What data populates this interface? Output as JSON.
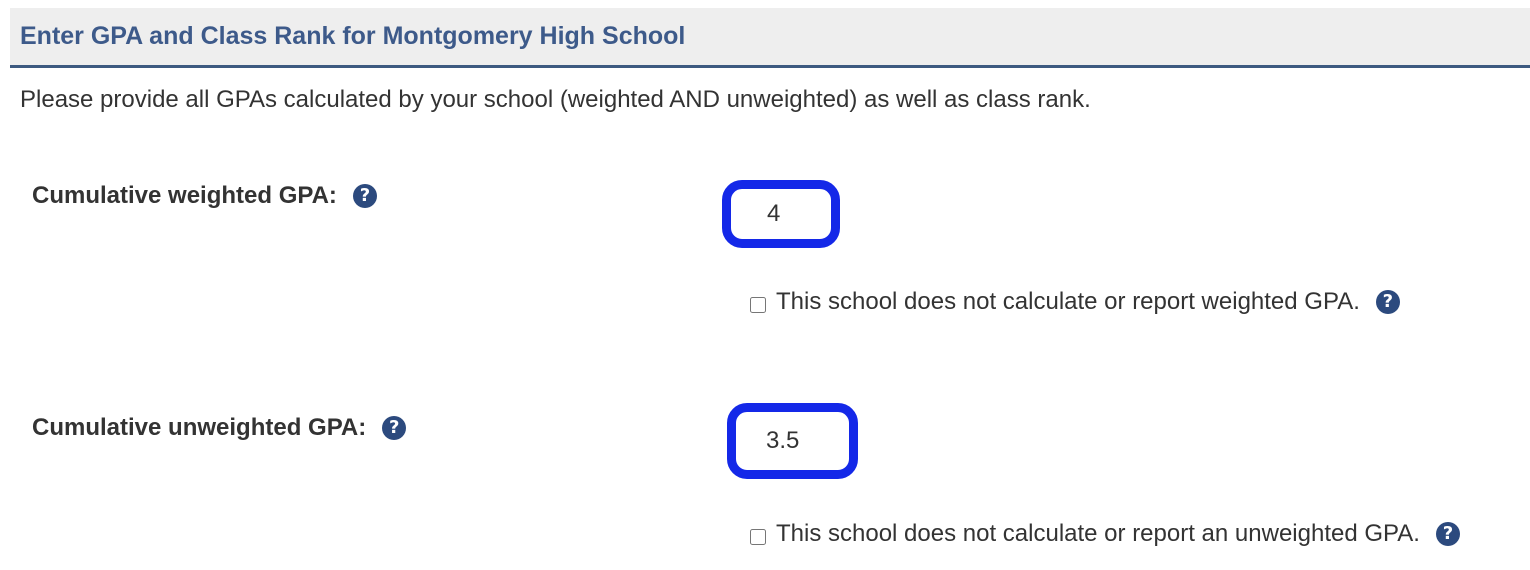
{
  "section": {
    "title": "Enter GPA and Class Rank for Montgomery High School",
    "intro": "Please provide all GPAs calculated by your school (weighted AND unweighted) as well as class rank."
  },
  "weighted": {
    "label": "Cumulative weighted GPA:",
    "value": "4",
    "checkbox_label": "This school does not calculate or report weighted GPA.",
    "checked": false
  },
  "unweighted": {
    "label": "Cumulative unweighted GPA:",
    "value": "3.5",
    "checkbox_label": "This school does not calculate or report an unweighted GPA.",
    "checked": false
  },
  "icons": {
    "help": "?"
  },
  "colors": {
    "header_bg": "#eeeeee",
    "header_text": "#3d5a8a",
    "header_rule": "#3d5a80",
    "input_border": "#1428e8",
    "help_icon": "#2c4a7e"
  }
}
